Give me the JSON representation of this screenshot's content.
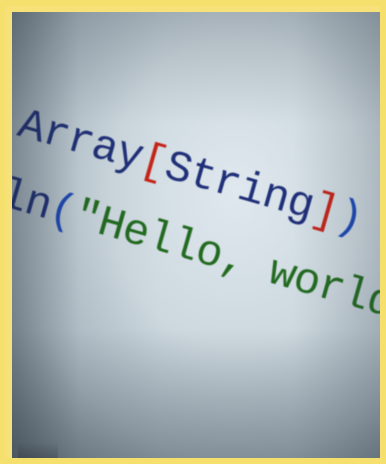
{
  "photo": {
    "line1": {
      "word": "Array",
      "open_bracket": "[",
      "type": "String",
      "close_bracket": "]",
      "close_paren": ")",
      "equals": "="
    },
    "line2": {
      "prefix": "ln",
      "open_paren": "(",
      "string": "\"Hello, world!\""
    }
  },
  "colors": {
    "frame": "#f6e06d",
    "identifier": "#1f2f78",
    "bracket": "#c42418",
    "paren": "#1b48b7",
    "string": "#216a1f"
  }
}
